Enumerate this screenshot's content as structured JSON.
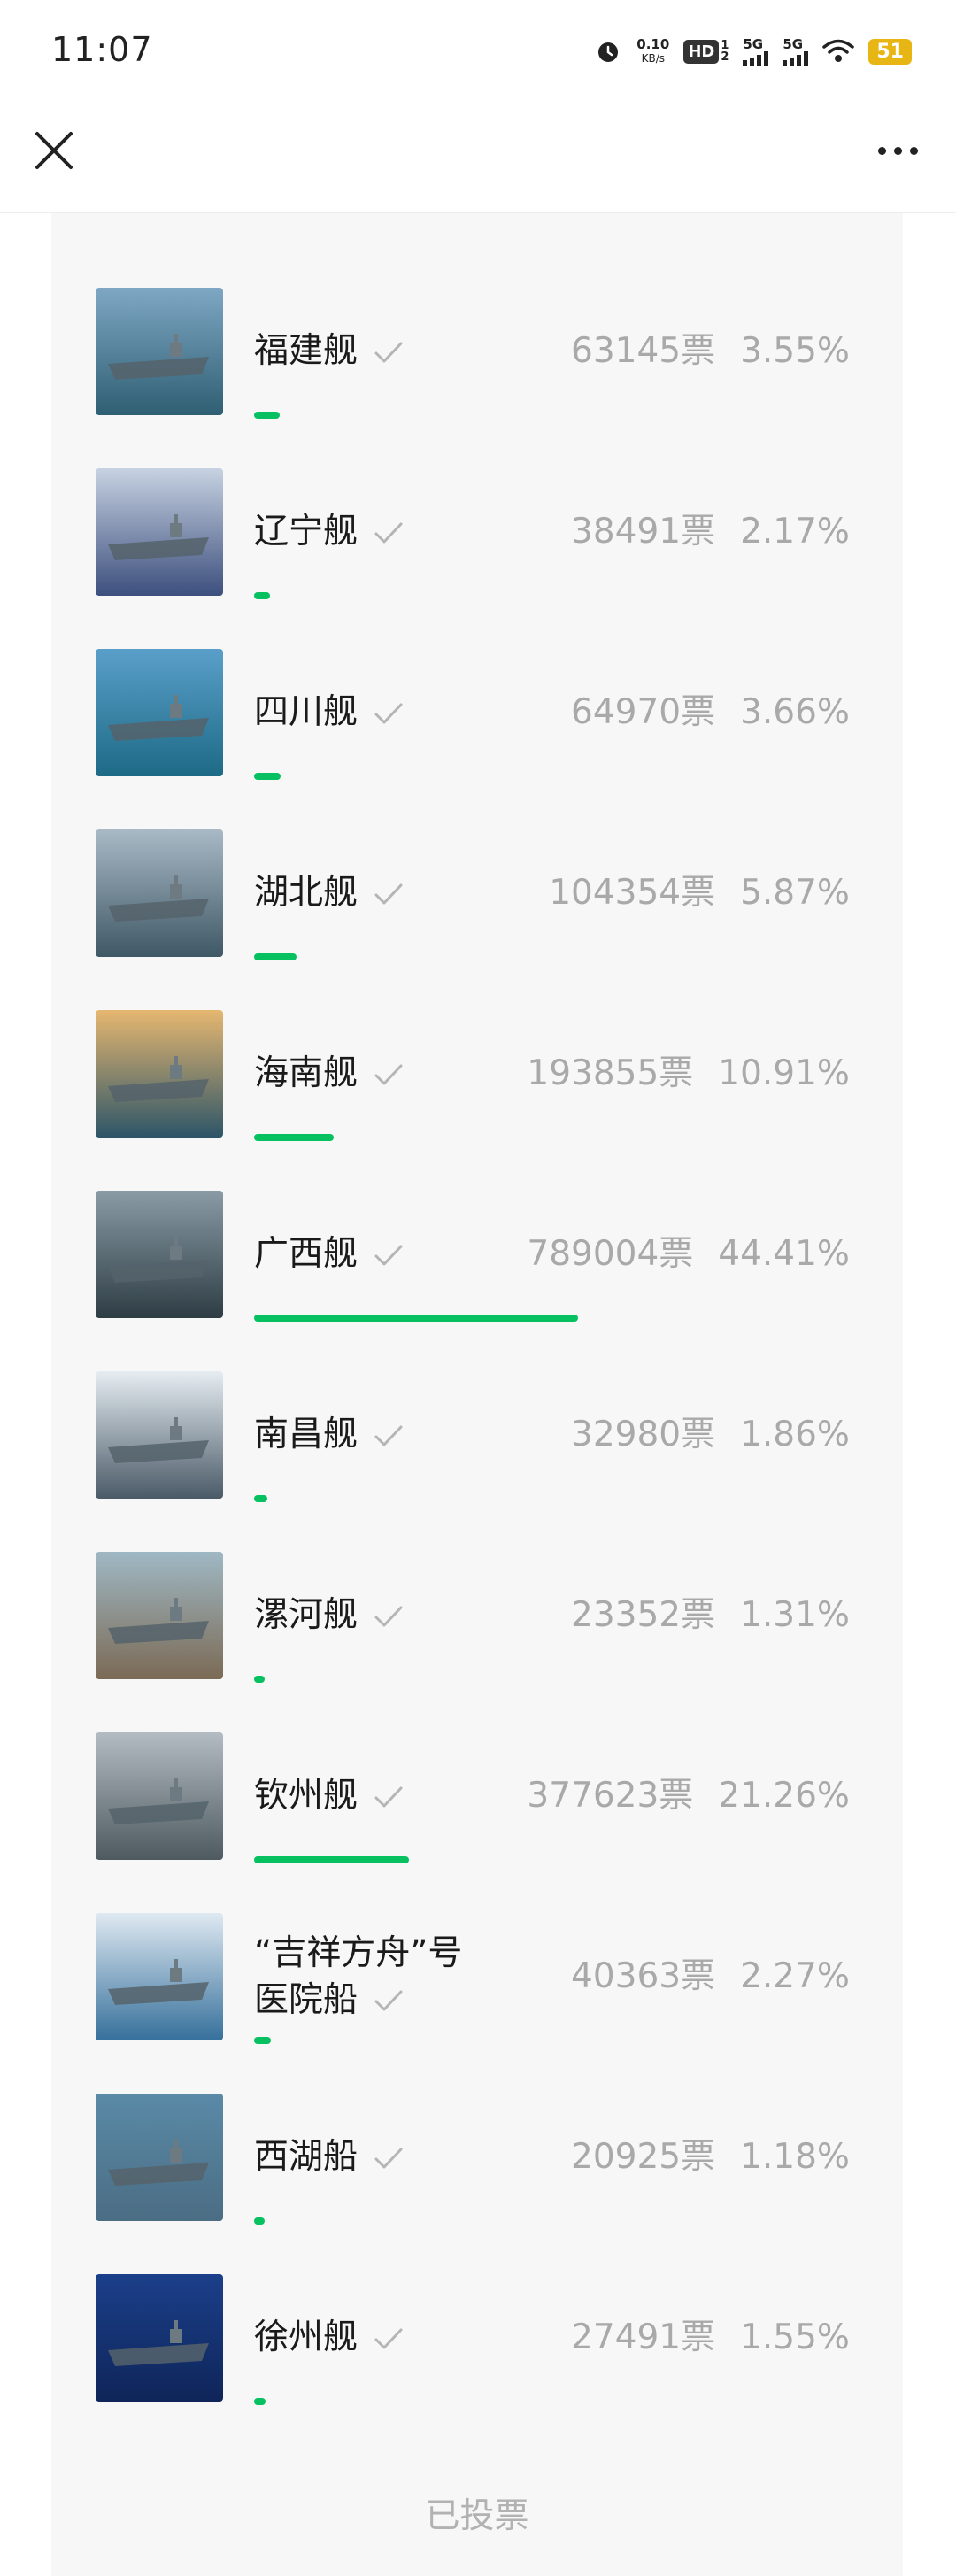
{
  "status": {
    "time": "11:07",
    "speed_top": "0.10",
    "speed_unit": "KB/s",
    "hd": "HD",
    "sim1": "5G",
    "sim2": "5G",
    "battery": "51"
  },
  "options": [
    {
      "name": "福建舰",
      "votes": "63145票",
      "percent": "3.55%",
      "ratio": 0.0355,
      "colors": [
        "#7ea7c4",
        "#2f5f73"
      ]
    },
    {
      "name": "辽宁舰",
      "votes": "38491票",
      "percent": "2.17%",
      "ratio": 0.0217,
      "colors": [
        "#c7d2e2",
        "#3d4f7d"
      ]
    },
    {
      "name": "四川舰",
      "votes": "64970票",
      "percent": "3.66%",
      "ratio": 0.0366,
      "colors": [
        "#5a9fc9",
        "#1d6a86"
      ]
    },
    {
      "name": "湖北舰",
      "votes": "104354票",
      "percent": "5.87%",
      "ratio": 0.0587,
      "colors": [
        "#a9b9c6",
        "#3f5865"
      ]
    },
    {
      "name": "海南舰",
      "votes": "193855票",
      "percent": "10.91%",
      "ratio": 0.1091,
      "colors": [
        "#e6b770",
        "#2d5568"
      ]
    },
    {
      "name": "广西舰",
      "votes": "789004票",
      "percent": "44.41%",
      "ratio": 0.4441,
      "colors": [
        "#8a9ba6",
        "#2e3d44"
      ]
    },
    {
      "name": "南昌舰",
      "votes": "32980票",
      "percent": "1.86%",
      "ratio": 0.0186,
      "colors": [
        "#e6edf2",
        "#4a5a67"
      ]
    },
    {
      "name": "漯河舰",
      "votes": "23352票",
      "percent": "1.31%",
      "ratio": 0.0131,
      "colors": [
        "#9fb8c4",
        "#7b6a55"
      ]
    },
    {
      "name": "钦州舰",
      "votes": "377623票",
      "percent": "21.26%",
      "ratio": 0.2126,
      "colors": [
        "#b3bcc2",
        "#4e5a60"
      ]
    },
    {
      "name": "“吉祥方舟”号",
      "name2": "医院船",
      "votes": "40363票",
      "percent": "2.27%",
      "ratio": 0.0227,
      "colors": [
        "#dfe9f2",
        "#36709b"
      ]
    },
    {
      "name": "西湖船",
      "votes": "20925票",
      "percent": "1.18%",
      "ratio": 0.0118,
      "colors": [
        "#5a8aa7",
        "#4b6d84"
      ]
    },
    {
      "name": "徐州舰",
      "votes": "27491票",
      "percent": "1.55%",
      "ratio": 0.0155,
      "colors": [
        "#1b3f8a",
        "#0f2559"
      ]
    }
  ],
  "footer": {
    "voted_label": "已投票"
  },
  "colors": {
    "accent": "#07c160",
    "muted": "#a9a9a9",
    "card_bg": "#f7f7f7"
  },
  "icons": {
    "close": "close-icon",
    "more": "more-icon",
    "check": "check-icon"
  }
}
